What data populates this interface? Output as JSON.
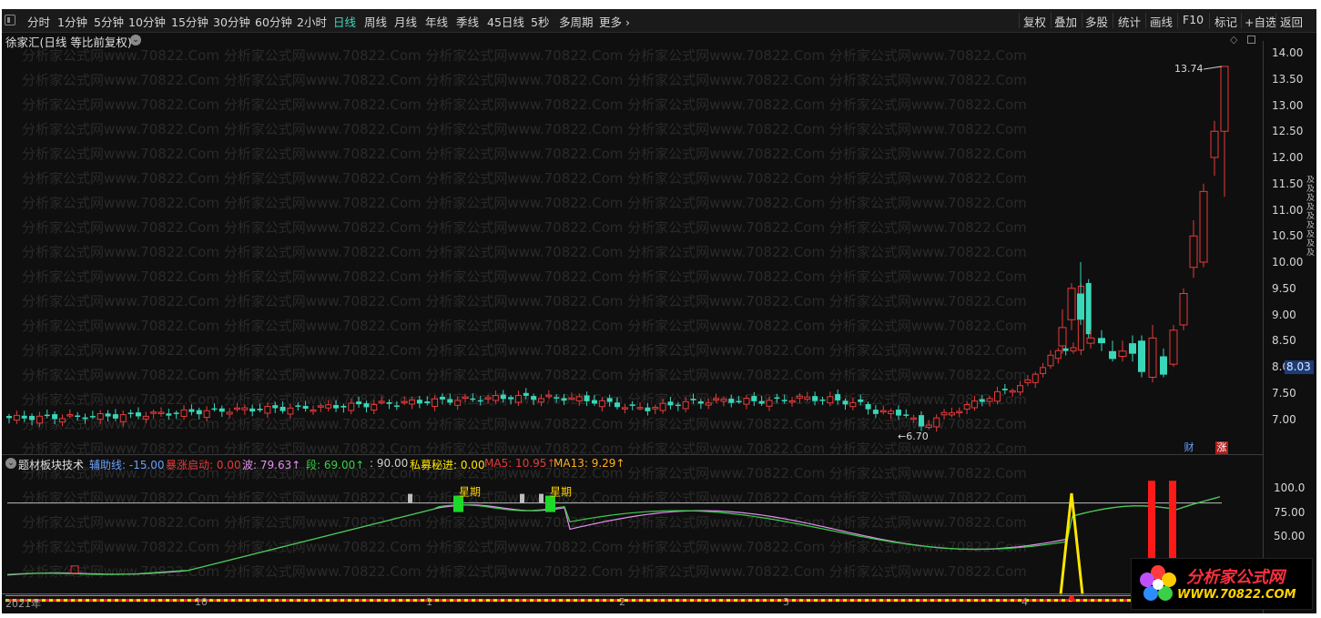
{
  "toolbar": {
    "periods": [
      "分时",
      "1分钟",
      "5分钟",
      "10分钟",
      "15分钟",
      "30分钟",
      "60分钟",
      "2小时",
      "日线",
      "周线",
      "月线",
      "年线",
      "季线",
      "45日线",
      "5秒",
      "多周期",
      "更多"
    ],
    "active_period": "日线",
    "right_buttons": [
      "复权",
      "叠加",
      "多股",
      "统计",
      "画线",
      "F10",
      "标记",
      "+自选",
      "返回"
    ]
  },
  "main_chart": {
    "title": "徐家汇(日线 等比前复权)",
    "y_ticks": [
      "14.00",
      "13.50",
      "13.00",
      "12.50",
      "12.00",
      "11.50",
      "11.00",
      "10.50",
      "10.00",
      "9.50",
      "9.00",
      "8.50",
      "8.00",
      "7.50",
      "7.00"
    ],
    "current_price": "8.03",
    "high_label": "13.74",
    "low_label": "6.70",
    "badge_finance": "财",
    "badge_rise": "涨",
    "right_tabs": "及及及及及及及及及",
    "watermark_line": "分析家公式网www.70822.Com 分析家公式网www.70822.Com 分析家公式网www.70822.Com 分析家公式网www.70822.Com 分析家公式网www.70822.Com"
  },
  "indicator": {
    "name": "题材板块技术",
    "values": [
      {
        "label": "辅助线: -15.00",
        "color": "#6aa0ff"
      },
      {
        "label": "暴涨启动: 0.00",
        "color": "#e83a3a"
      },
      {
        "label": "波: 79.63↑",
        "color": "#e58ff0"
      },
      {
        "label": "段: 69.00↑",
        "color": "#3ad04a"
      },
      {
        "label": ": 90.00",
        "color": "#cfcfcf"
      },
      {
        "label": "私募秘进: 0.00",
        "color": "#ffe600"
      },
      {
        "label": "MA5: 10.95↑",
        "color": "#e83a3a"
      },
      {
        "label": "MA13: 9.29↑",
        "color": "#ffb020"
      }
    ],
    "y_ticks": [
      "100.0",
      "75.00",
      "50.00"
    ],
    "marker_labels": [
      "星期",
      "星期"
    ],
    "bottom_ticks": [
      "2021年",
      "10",
      "1",
      "2",
      "3",
      "4"
    ]
  },
  "logo": {
    "text": "分析家公式网",
    "url": "WWW.70822.COM"
  },
  "colors": {
    "up": "#e83a3a",
    "down": "#3ad6b8",
    "background": "#0f0f0f",
    "accent": "#3fd8c0"
  }
}
